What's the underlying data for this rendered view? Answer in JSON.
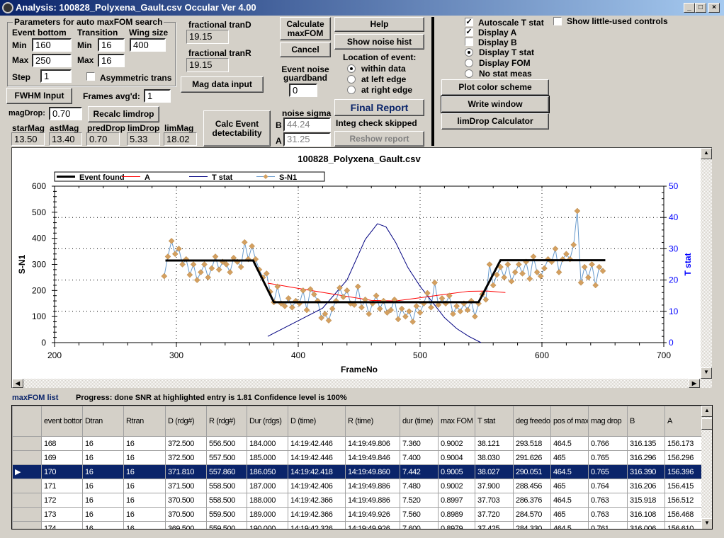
{
  "window": {
    "title": "Analysis: 100828_Polyxena_Gault.csv  Occular Ver 4.00",
    "minimize": "_",
    "maximize": "□",
    "close": "×"
  },
  "params": {
    "group_title": "Parameters for auto maxFOM search",
    "event_bottom_label": "Event bottom",
    "transition_label": "Transition",
    "wing_size_label": "Wing size",
    "min_label": "Min",
    "max_label": "Max",
    "step_label": "Step",
    "eb_min": "160",
    "eb_max": "250",
    "tr_min": "16",
    "tr_max": "16",
    "wing": "400",
    "step": "1",
    "asym_label": "Asymmetric trans",
    "asym_checked": false
  },
  "fwhm_button": "FWHM Input",
  "frames_avg_label": "Frames avg'd:",
  "frames_avg": "1",
  "magdrop_label": "magDrop:",
  "magdrop": "0.70",
  "recalc_button": "Recalc limdrop",
  "mags": [
    {
      "label": "starMag",
      "value": "13.50"
    },
    {
      "label": "astMag",
      "value": "13.40"
    },
    {
      "label": "predDrop",
      "value": "0.70"
    },
    {
      "label": "limDrop",
      "value": "5.33"
    },
    {
      "label": "limMag",
      "value": "18.02"
    }
  ],
  "frac_trand_label": "fractional tranD",
  "frac_trand": "19.15",
  "frac_tranr_label": "fractional tranR",
  "frac_tranr": "19.15",
  "mag_data_button": "Mag data input",
  "calc_event_button": "Calc Event detectability",
  "calc_maxfom_button": "Calculate maxFOM",
  "cancel_button": "Cancel",
  "guardband_label": "Event noise guardband",
  "guardband": "0",
  "noise_sigma_label": "noise sigma",
  "noise_b_label": "B",
  "noise_b": "44.24",
  "noise_a_label": "A",
  "noise_a": "31.25",
  "help_button": "Help",
  "noise_hist_button": "Show noise hist",
  "location_label": "Location of event:",
  "location_options": [
    "within data",
    "at left edge",
    "at right edge"
  ],
  "location_selected": "within data",
  "final_report_button": "Final Report",
  "integ_status": "Integ check skipped",
  "reshow_button": "Reshow report",
  "checks": [
    {
      "label": "Autoscale T stat",
      "checked": true
    },
    {
      "label": "Display A",
      "checked": true
    },
    {
      "label": "Display B",
      "checked": false
    }
  ],
  "stat_options": [
    "Display T stat",
    "Display FOM",
    "No stat meas"
  ],
  "stat_selected": "Display T stat",
  "little_used_label": "Show little-used controls",
  "little_used_checked": false,
  "plot_color_button": "Plot color scheme",
  "write_window_button": "Write window",
  "limdrop_calc_button": "limDrop Calculator",
  "chart_data": {
    "type": "line",
    "title": "100828_Polyxena_Gault.csv",
    "xlabel": "FrameNo",
    "ylabel": "S-N1",
    "y2label": "T stat",
    "xlim": [
      200,
      700
    ],
    "ylim": [
      0,
      600
    ],
    "y2lim": [
      0,
      50
    ],
    "xticks": [
      200,
      300,
      400,
      500,
      600,
      700
    ],
    "yticks": [
      0,
      100,
      200,
      300,
      400,
      500,
      600
    ],
    "y2ticks": [
      0,
      10,
      20,
      30,
      40,
      50
    ],
    "grid": "dotted",
    "legend_placement": "top-left",
    "legend": [
      "Event found",
      "A",
      "T stat",
      "S-N1"
    ],
    "colors": {
      "event": "#000000",
      "A": "#ff0000",
      "tstat": "#000080",
      "sn1_line": "#6699cc",
      "sn1_marker": "#d4a060",
      "y2axis": "#0000ff"
    },
    "event_found": {
      "x": [
        291,
        363,
        380,
        548,
        566,
        652
      ],
      "y": [
        315,
        315,
        155,
        155,
        316,
        316
      ]
    },
    "A": {
      "x": [
        375,
        400,
        430,
        460,
        480,
        500,
        520,
        540,
        555,
        570
      ],
      "y": [
        228,
        208,
        185,
        162,
        160,
        172,
        185,
        197,
        198,
        192
      ]
    },
    "tstat": {
      "x": [
        375,
        400,
        420,
        440,
        455,
        465,
        472,
        480,
        490,
        500,
        510,
        520,
        530,
        540,
        550
      ],
      "y": [
        2,
        7,
        11,
        20,
        33,
        38,
        37,
        32,
        24,
        18,
        13,
        8,
        4.5,
        2,
        0
      ]
    },
    "sn1": {
      "x_start": 290,
      "x_step": 3,
      "y": [
        255,
        330,
        390,
        340,
        360,
        300,
        320,
        260,
        300,
        240,
        270,
        300,
        250,
        285,
        330,
        280,
        310,
        300,
        270,
        325,
        310,
        290,
        385,
        320,
        370,
        320,
        280,
        250,
        265,
        195,
        155,
        215,
        150,
        140,
        170,
        135,
        160,
        150,
        200,
        125,
        205,
        185,
        160,
        95,
        110,
        85,
        130,
        160,
        210,
        175,
        200,
        150,
        145,
        215,
        135,
        165,
        110,
        150,
        180,
        130,
        160,
        115,
        125,
        165,
        90,
        130,
        100,
        120,
        80,
        140,
        115,
        150,
        190,
        135,
        230,
        145,
        170,
        150,
        180,
        110,
        140,
        120,
        150,
        125,
        160,
        100,
        150,
        185,
        165,
        300,
        220,
        260,
        290,
        250,
        300,
        235,
        270,
        300,
        265,
        310,
        245,
        330,
        270,
        255,
        285,
        320,
        310,
        360,
        270,
        320,
        340,
        320,
        375,
        505,
        230,
        290,
        250,
        300,
        220,
        290,
        275
      ]
    }
  },
  "list": {
    "title": "maxFOM list",
    "progress": "Progress: done  SNR at highlighted entry is 1.81   Confidence level is  100%",
    "columns": [
      "event bottom rdgs",
      "Dtran",
      "Rtran",
      "D (rdg#)",
      "R (rdg#)",
      "Dur (rdgs)",
      "D (time)",
      "R (time)",
      "dur (time)",
      "max FOM",
      "T stat",
      "deg freedom",
      "pos of max",
      "mag drop",
      "B",
      "A"
    ],
    "selected_index": 2,
    "rows": [
      [
        "168",
        "16",
        "16",
        "372.500",
        "556.500",
        "184.000",
        "14:19:42.446",
        "14:19:49.806",
        "7.360",
        "0.9002",
        "38.121",
        "293.518",
        "464.5",
        "0.766",
        "316.135",
        "156.173"
      ],
      [
        "169",
        "16",
        "16",
        "372.500",
        "557.500",
        "185.000",
        "14:19:42.446",
        "14:19:49.846",
        "7.400",
        "0.9004",
        "38.030",
        "291.626",
        "465",
        "0.765",
        "316.296",
        "156.296"
      ],
      [
        "170",
        "16",
        "16",
        "371.810",
        "557.860",
        "186.050",
        "14:19:42.418",
        "14:19:49.860",
        "7.442",
        "0.9005",
        "38.027",
        "290.051",
        "464.5",
        "0.765",
        "316.390",
        "156.396"
      ],
      [
        "171",
        "16",
        "16",
        "371.500",
        "558.500",
        "187.000",
        "14:19:42.406",
        "14:19:49.886",
        "7.480",
        "0.9002",
        "37.900",
        "288.456",
        "465",
        "0.764",
        "316.206",
        "156.415"
      ],
      [
        "172",
        "16",
        "16",
        "370.500",
        "558.500",
        "188.000",
        "14:19:42.366",
        "14:19:49.886",
        "7.520",
        "0.8997",
        "37.703",
        "286.376",
        "464.5",
        "0.763",
        "315.918",
        "156.512"
      ],
      [
        "173",
        "16",
        "16",
        "370.500",
        "559.500",
        "189.000",
        "14:19:42.366",
        "14:19:49.926",
        "7.560",
        "0.8989",
        "37.720",
        "284.570",
        "465",
        "0.763",
        "316.108",
        "156.468"
      ],
      [
        "174",
        "16",
        "16",
        "369.500",
        "559.500",
        "190.000",
        "14:19:42.326",
        "14:19:49.926",
        "7.600",
        "0.8979",
        "37.425",
        "284.330",
        "464.5",
        "0.761",
        "316.006",
        "156.610"
      ]
    ]
  }
}
